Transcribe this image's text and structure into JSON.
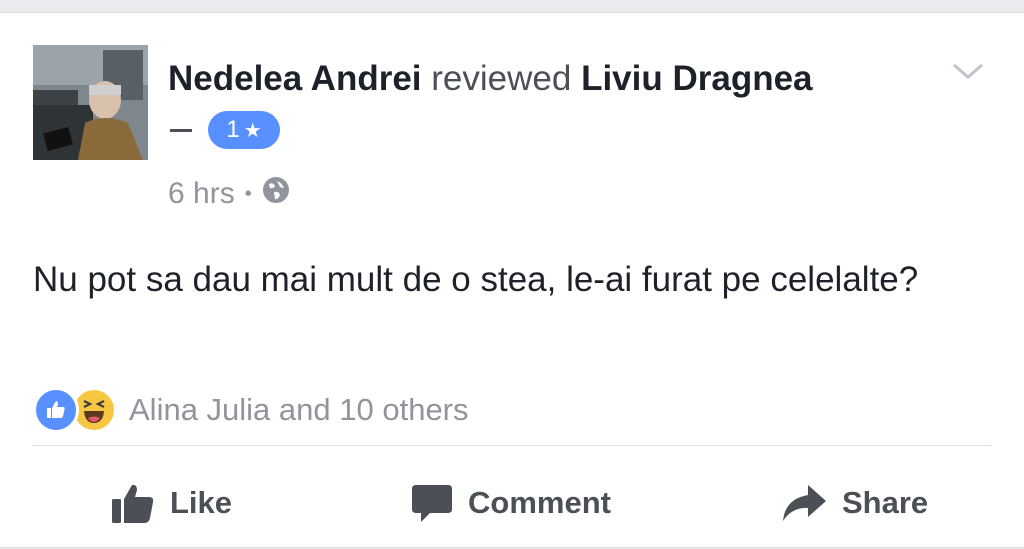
{
  "post": {
    "author": "Nedelea Andrei",
    "verb": "reviewed",
    "page": "Liviu Dragnea",
    "rating": "1",
    "time": "6 hrs",
    "separator": "•",
    "review_text": "Nu pot sa dau mai mult de o stea, le-ai furat pe celelalte?"
  },
  "reactions": {
    "summary": "Alina Julia and 10 others",
    "icons": [
      "like-icon",
      "haha-icon"
    ]
  },
  "actions": {
    "like": "Like",
    "comment": "Comment",
    "share": "Share"
  },
  "colors": {
    "accent": "#5890ff",
    "text": "#1d2129",
    "muted": "#90949c",
    "haha": "#f7c744"
  }
}
